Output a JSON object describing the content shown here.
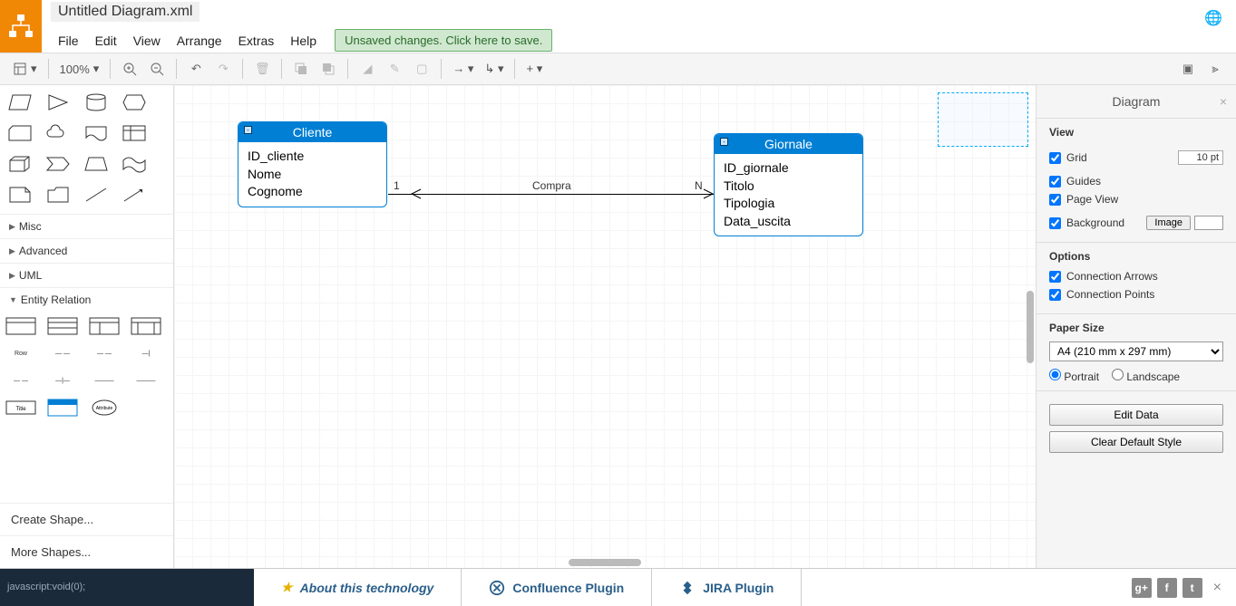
{
  "app": {
    "filename": "Untitled Diagram.xml"
  },
  "menu": {
    "file": "File",
    "edit": "Edit",
    "view": "View",
    "arrange": "Arrange",
    "extras": "Extras",
    "help": "Help",
    "save": "Unsaved changes. Click here to save."
  },
  "toolbar": {
    "zoom": "100%"
  },
  "sidebar": {
    "cats": {
      "misc": "Misc",
      "advanced": "Advanced",
      "uml": "UML",
      "er": "Entity Relation"
    },
    "row_label": "Row",
    "create": "Create Shape...",
    "more": "More Shapes..."
  },
  "canvas": {
    "entity1": {
      "title": "Cliente",
      "attrs": [
        "ID_cliente",
        "Nome",
        "Cognome"
      ]
    },
    "entity2": {
      "title": "Giornale",
      "attrs": [
        "ID_giornale",
        "Titolo",
        "Tipologia",
        "Data_uscita"
      ]
    },
    "rel": {
      "label": "Compra",
      "left": "1",
      "right": "N"
    }
  },
  "panel": {
    "title": "Diagram",
    "view": "View",
    "grid": "Grid",
    "grid_val": "10 pt",
    "guides": "Guides",
    "pageview": "Page View",
    "background": "Background",
    "image_btn": "Image",
    "options": "Options",
    "conn_arrows": "Connection Arrows",
    "conn_points": "Connection Points",
    "paper": "Paper Size",
    "paper_val": "A4 (210 mm x 297 mm)",
    "portrait": "Portrait",
    "landscape": "Landscape",
    "edit_data": "Edit Data",
    "clear_style": "Clear Default Style"
  },
  "footer": {
    "status": "javascript:void(0);",
    "tab1": "About this technology",
    "tab2": "Confluence Plugin",
    "tab3": "JIRA Plugin"
  }
}
